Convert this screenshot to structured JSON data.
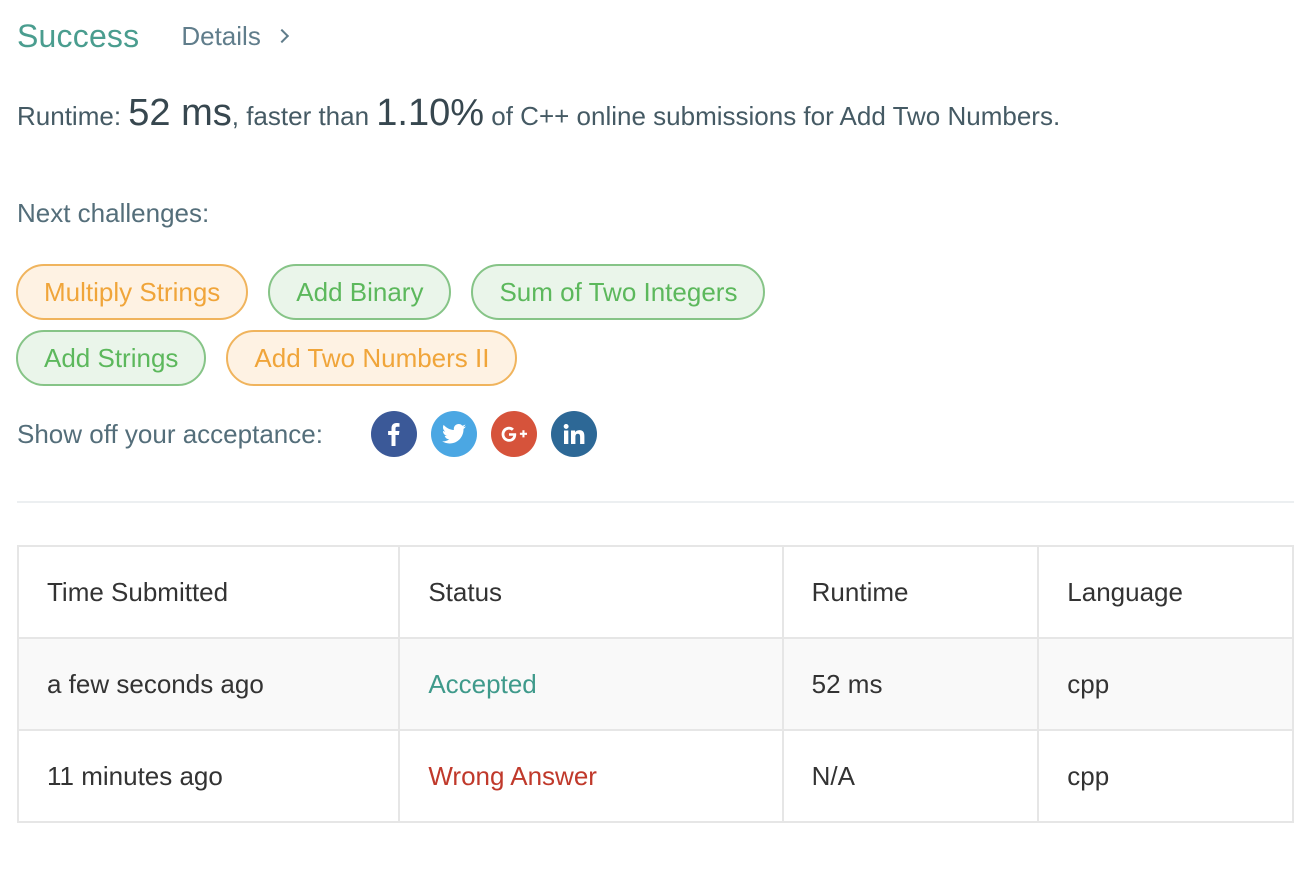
{
  "header": {
    "status": "Success",
    "details_label": "Details"
  },
  "runtime": {
    "prefix": "Runtime: ",
    "value": "52 ms",
    "middle": ", faster than ",
    "percentile": "1.10%",
    "suffix": " of C++ online submissions for Add Two Numbers."
  },
  "next_challenges": {
    "label": "Next challenges:",
    "rows": [
      [
        {
          "label": "Multiply Strings",
          "difficulty": "medium"
        },
        {
          "label": "Add Binary",
          "difficulty": "easy"
        },
        {
          "label": "Sum of Two Integers",
          "difficulty": "easy"
        }
      ],
      [
        {
          "label": "Add Strings",
          "difficulty": "easy"
        },
        {
          "label": "Add Two Numbers II",
          "difficulty": "medium"
        }
      ]
    ]
  },
  "share": {
    "label": "Show off your acceptance:",
    "icons": [
      {
        "name": "facebook-icon",
        "color": "#3b5998"
      },
      {
        "name": "twitter-icon",
        "color": "#4ba7e3"
      },
      {
        "name": "google-plus-icon",
        "color": "#d6533b"
      },
      {
        "name": "linkedin-icon",
        "color": "#2d6896"
      }
    ]
  },
  "colors": {
    "success": "#4a9d8f",
    "medium_text": "#f0a53a",
    "easy_text": "#5cb85c",
    "accepted": "#3f9a8b",
    "wrong_answer": "#c0392b"
  },
  "table": {
    "headers": [
      "Time Submitted",
      "Status",
      "Runtime",
      "Language"
    ],
    "rows": [
      {
        "time": "a few seconds ago",
        "status": "Accepted",
        "status_type": "accepted",
        "runtime": "52 ms",
        "language": "cpp"
      },
      {
        "time": "11 minutes ago",
        "status": "Wrong Answer",
        "status_type": "wrong",
        "runtime": "N/A",
        "language": "cpp"
      }
    ]
  }
}
